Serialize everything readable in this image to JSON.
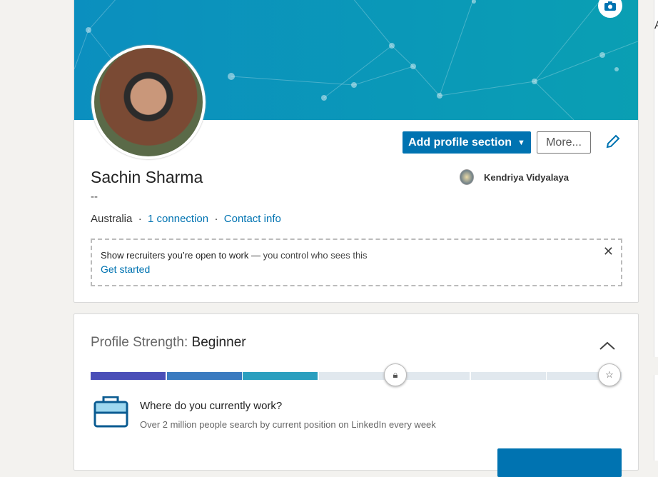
{
  "profile": {
    "name": "Sachin Sharma",
    "headline": "--",
    "location": "Australia",
    "connections": "1 connection",
    "contact": "Contact info",
    "school": "Kendriya Vidyalaya"
  },
  "actions": {
    "add_section": "Add profile section",
    "more": "More..."
  },
  "open_to_work": {
    "text_bold": "Show recruiters you’re open to work —",
    "text_rest": " you control who sees this",
    "link": "Get started"
  },
  "strength": {
    "label": "Profile Strength: ",
    "level": "Beginner",
    "segments_total": 7,
    "segments_filled": 3,
    "question": "Where do you currently work?",
    "subtext": "Over 2 million people search by current position on LinkedIn every week"
  },
  "right_panel": {
    "letter": "A"
  },
  "colors": {
    "primary": "#0073b1",
    "banner": "#0a9fb3",
    "seg1": "#4a4fb8",
    "seg2": "#3a7bc0",
    "seg3": "#2a9fbf",
    "seg_empty": "#e1e8ee"
  }
}
